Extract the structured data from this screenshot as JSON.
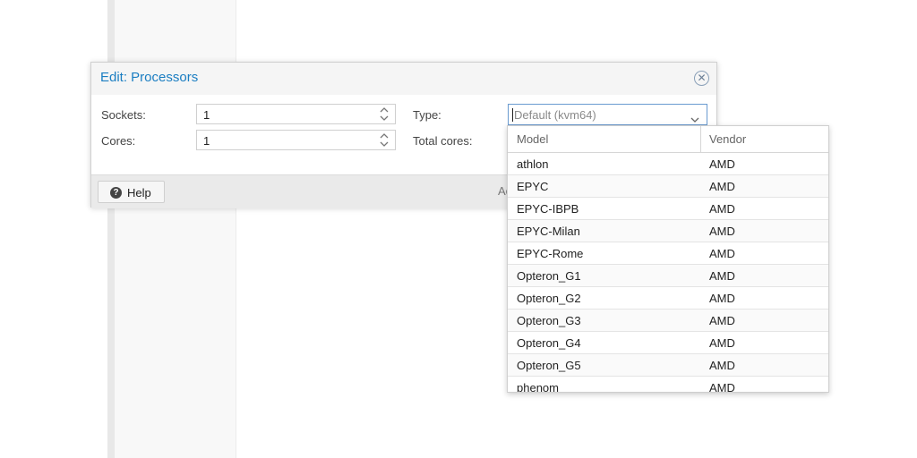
{
  "dialog": {
    "title": "Edit: Processors",
    "sockets_label": "Sockets:",
    "sockets_value": "1",
    "cores_label": "Cores:",
    "cores_value": "1",
    "type_label": "Type:",
    "type_placeholder": "Default (kvm64)",
    "total_cores_label": "Total cores:",
    "help_label": "Help",
    "footer_partial_text": "Ac"
  },
  "picker": {
    "columns": [
      "Model",
      "Vendor"
    ],
    "rows": [
      {
        "model": "athlon",
        "vendor": "AMD"
      },
      {
        "model": "EPYC",
        "vendor": "AMD"
      },
      {
        "model": "EPYC-IBPB",
        "vendor": "AMD"
      },
      {
        "model": "EPYC-Milan",
        "vendor": "AMD"
      },
      {
        "model": "EPYC-Rome",
        "vendor": "AMD"
      },
      {
        "model": "Opteron_G1",
        "vendor": "AMD"
      },
      {
        "model": "Opteron_G2",
        "vendor": "AMD"
      },
      {
        "model": "Opteron_G3",
        "vendor": "AMD"
      },
      {
        "model": "Opteron_G4",
        "vendor": "AMD"
      },
      {
        "model": "Opteron_G5",
        "vendor": "AMD"
      },
      {
        "model": "phenom",
        "vendor": "AMD"
      }
    ]
  },
  "colors": {
    "title_blue": "#1b7ec2",
    "focus_border": "#6a9bd0"
  }
}
